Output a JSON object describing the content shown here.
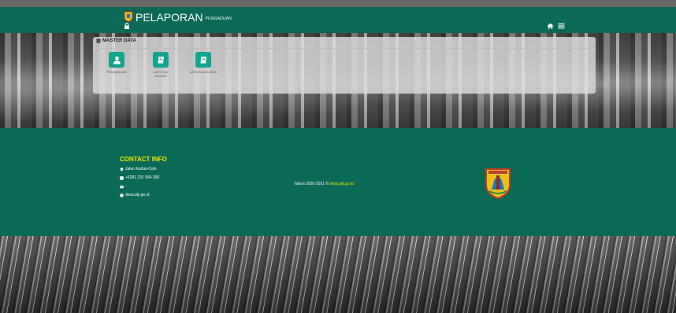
{
  "header": {
    "title": "PELAPORAN",
    "subtitle": "PENGADUAN",
    "logo_icon": "regency-emblem-icon",
    "left_icon": "lock-icon",
    "right_icons": [
      "home-icon",
      "menu-icon"
    ]
  },
  "master_data": {
    "heading": "MASTER DATA",
    "heading_icon": "database-icon",
    "tiles": [
      {
        "label": "PENGADUAN",
        "icon": "user-icon"
      },
      {
        "label": "LAPORAN KELUAR",
        "icon": "book-icon"
      },
      {
        "label": "LAPORAN MASUK",
        "icon": "book-icon"
      }
    ]
  },
  "footer": {
    "contact_title": "CONTACT INFO",
    "address": "Jalan Kudus-Colo",
    "phone": "+6281 231 964 300",
    "email": "-",
    "website": "desa.piji.go.id",
    "copyright_prefix": "Tahun 2020-2021 ©",
    "copyright_site": "desa.piji.go.id"
  },
  "colors": {
    "primary_green": "#0b6a55",
    "tile_teal": "#13a58f",
    "accent_yellow": "#f2e600"
  }
}
